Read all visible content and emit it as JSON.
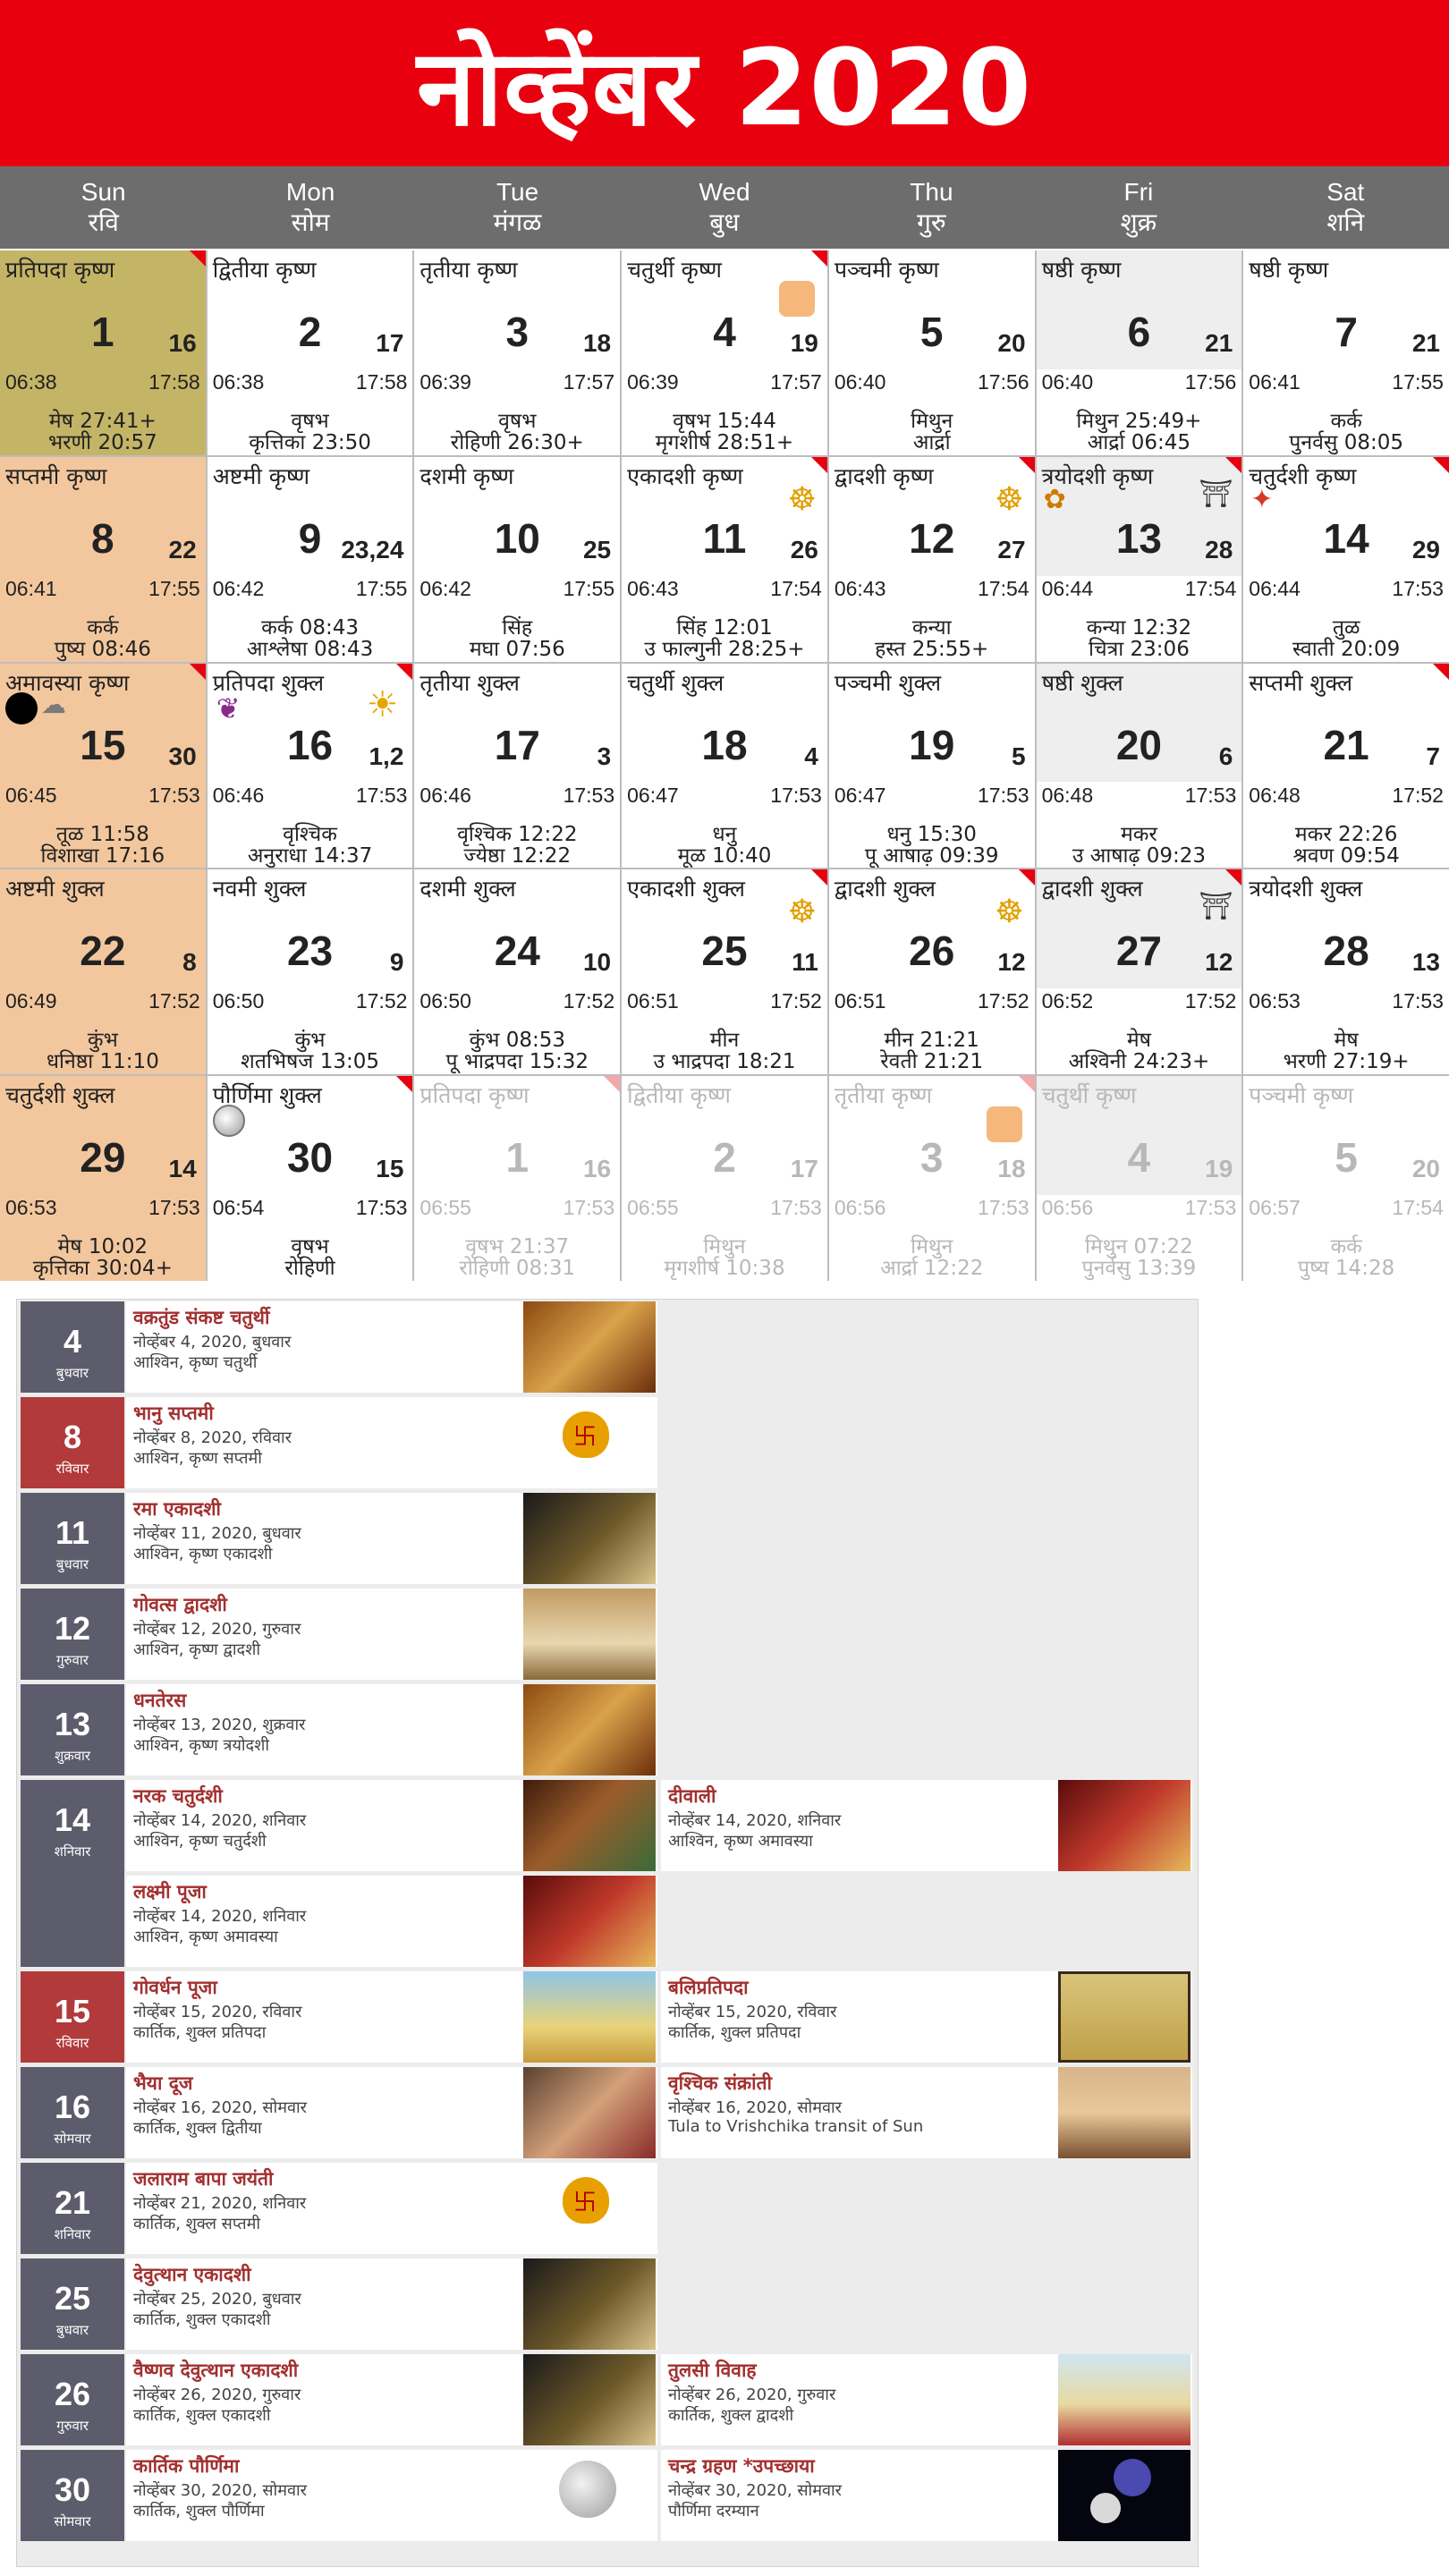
{
  "header": {
    "title": "नोव्हेंबर 2020"
  },
  "day_headers": [
    {
      "en": "Sun",
      "mr": "रवि"
    },
    {
      "en": "Mon",
      "mr": "सोम"
    },
    {
      "en": "Tue",
      "mr": "मंगळ"
    },
    {
      "en": "Wed",
      "mr": "बुध"
    },
    {
      "en": "Thu",
      "mr": "गुरु"
    },
    {
      "en": "Fri",
      "mr": "शुक्र"
    },
    {
      "en": "Sat",
      "mr": "शनि"
    }
  ],
  "calendar": {
    "cells": [
      {
        "tithi": "प्रतिपदा कृष्ण",
        "day": "1",
        "lunar": "16",
        "rise": "06:38",
        "set": "17:58",
        "l1": "मेष 27:41+",
        "l2": "भरणी 20:57",
        "style": "today",
        "corner": true
      },
      {
        "tithi": "द्वितीया कृष्ण",
        "day": "2",
        "lunar": "17",
        "rise": "06:38",
        "set": "17:58",
        "l1": "वृषभ",
        "l2": "कृत्तिका 23:50"
      },
      {
        "tithi": "तृतीया कृष्ण",
        "day": "3",
        "lunar": "18",
        "rise": "06:39",
        "set": "17:57",
        "l1": "वृषभ",
        "l2": "रोहिणी 26:30+"
      },
      {
        "tithi": "चतुर्थी कृष्ण",
        "day": "4",
        "lunar": "19",
        "rise": "06:39",
        "set": "17:57",
        "l1": "वृषभ 15:44",
        "l2": "मृगशीर्ष 28:51+",
        "corner": true,
        "icon": "ganesha-icon"
      },
      {
        "tithi": "पञ्चमी कृष्ण",
        "day": "5",
        "lunar": "20",
        "rise": "06:40",
        "set": "17:56",
        "l1": "मिथुन",
        "l2": "आर्द्रा"
      },
      {
        "tithi": "षष्ठी कृष्ण",
        "day": "6",
        "lunar": "21",
        "rise": "06:40",
        "set": "17:56",
        "l1": "मिथुन 25:49+",
        "l2": "आर्द्रा 06:45",
        "style": "shade"
      },
      {
        "tithi": "षष्ठी कृष्ण",
        "day": "7",
        "lunar": "21",
        "rise": "06:41",
        "set": "17:55",
        "l1": "कर्क",
        "l2": "पुनर्वसु 08:05"
      },
      {
        "tithi": "सप्तमी कृष्ण",
        "day": "8",
        "lunar": "22",
        "rise": "06:41",
        "set": "17:55",
        "l1": "कर्क",
        "l2": "पुष्य 08:46",
        "style": "sun"
      },
      {
        "tithi": "अष्टमी कृष्ण",
        "day": "9",
        "lunar": "23,24",
        "rise": "06:42",
        "set": "17:55",
        "l1": "कर्क 08:43",
        "l2": "आश्लेषा 08:43"
      },
      {
        "tithi": "दशमी कृष्ण",
        "day": "10",
        "lunar": "25",
        "rise": "06:42",
        "set": "17:55",
        "l1": "सिंह",
        "l2": "मघा 07:56"
      },
      {
        "tithi": "एकादशी कृष्ण",
        "day": "11",
        "lunar": "26",
        "rise": "06:43",
        "set": "17:54",
        "l1": "सिंह 12:01",
        "l2": "उ फाल्गुनी 28:25+",
        "corner": true,
        "icon": "vishnu-icon"
      },
      {
        "tithi": "द्वादशी कृष्ण",
        "day": "12",
        "lunar": "27",
        "rise": "06:43",
        "set": "17:54",
        "l1": "कन्या",
        "l2": "हस्त 25:55+",
        "corner": true,
        "icon": "vishnu-icon"
      },
      {
        "tithi": "त्रयोदशी कृष्ण",
        "day": "13",
        "lunar": "28",
        "rise": "06:44",
        "set": "17:54",
        "l1": "कन्या 12:32",
        "l2": "चित्रा 23:06",
        "style": "shade",
        "corner": true,
        "icon": "lakshmi-shiva-icon"
      },
      {
        "tithi": "चतुर्दशी कृष्ण",
        "day": "14",
        "lunar": "29",
        "rise": "06:44",
        "set": "17:53",
        "l1": "तुळ",
        "l2": "स्वाती 20:09",
        "corner": true,
        "icon": "diya-icon"
      },
      {
        "tithi": "अमावस्या कृष्ण",
        "day": "15",
        "lunar": "30",
        "rise": "06:45",
        "set": "17:53",
        "l1": "तूळ 11:58",
        "l2": "विशाखा 17:16",
        "style": "sun",
        "corner": true,
        "icon": "new-moon-icon"
      },
      {
        "tithi": "प्रतिपदा शुक्ल",
        "day": "16",
        "lunar": "1,2",
        "rise": "06:46",
        "set": "17:53",
        "l1": "वृश्चिक",
        "l2": "अनुराधा 14:37",
        "corner": true,
        "icon": "bhaidooj-sun-icon"
      },
      {
        "tithi": "तृतीया शुक्ल",
        "day": "17",
        "lunar": "3",
        "rise": "06:46",
        "set": "17:53",
        "l1": "वृश्चिक 12:22",
        "l2": "ज्येष्ठा 12:22"
      },
      {
        "tithi": "चतुर्थी शुक्ल",
        "day": "18",
        "lunar": "4",
        "rise": "06:47",
        "set": "17:53",
        "l1": "धनु",
        "l2": "मूळ 10:40"
      },
      {
        "tithi": "पञ्चमी शुक्ल",
        "day": "19",
        "lunar": "5",
        "rise": "06:47",
        "set": "17:53",
        "l1": "धनु 15:30",
        "l2": "पू आषाढ़ 09:39"
      },
      {
        "tithi": "षष्ठी शुक्ल",
        "day": "20",
        "lunar": "6",
        "rise": "06:48",
        "set": "17:53",
        "l1": "मकर",
        "l2": "उ आषाढ़ 09:23",
        "style": "shade"
      },
      {
        "tithi": "सप्तमी शुक्ल",
        "day": "21",
        "lunar": "7",
        "rise": "06:48",
        "set": "17:52",
        "l1": "मकर 22:26",
        "l2": "श्रवण 09:54",
        "corner": true
      },
      {
        "tithi": "अष्टमी शुक्ल",
        "day": "22",
        "lunar": "8",
        "rise": "06:49",
        "set": "17:52",
        "l1": "कुंभ",
        "l2": "धनिष्ठा 11:10",
        "style": "sun"
      },
      {
        "tithi": "नवमी शुक्ल",
        "day": "23",
        "lunar": "9",
        "rise": "06:50",
        "set": "17:52",
        "l1": "कुंभ",
        "l2": "शतभिषज 13:05"
      },
      {
        "tithi": "दशमी शुक्ल",
        "day": "24",
        "lunar": "10",
        "rise": "06:50",
        "set": "17:52",
        "l1": "कुंभ 08:53",
        "l2": "पू भाद्रपदा 15:32"
      },
      {
        "tithi": "एकादशी शुक्ल",
        "day": "25",
        "lunar": "11",
        "rise": "06:51",
        "set": "17:52",
        "l1": "मीन",
        "l2": "उ भाद्रपदा 18:21",
        "corner": true,
        "icon": "vishnu-icon"
      },
      {
        "tithi": "द्वादशी शुक्ल",
        "day": "26",
        "lunar": "12",
        "rise": "06:51",
        "set": "17:52",
        "l1": "मीन 21:21",
        "l2": "रेवती 21:21",
        "corner": true,
        "icon": "vishnu-icon"
      },
      {
        "tithi": "द्वादशी शुक्ल",
        "day": "27",
        "lunar": "12",
        "rise": "06:52",
        "set": "17:52",
        "l1": "मेष",
        "l2": "अश्विनी 24:23+",
        "style": "shade",
        "corner": true,
        "icon": "shiva-icon"
      },
      {
        "tithi": "त्रयोदशी शुक्ल",
        "day": "28",
        "lunar": "13",
        "rise": "06:53",
        "set": "17:53",
        "l1": "मेष",
        "l2": "भरणी 27:19+"
      },
      {
        "tithi": "चतुर्दशी शुक्ल",
        "day": "29",
        "lunar": "14",
        "rise": "06:53",
        "set": "17:53",
        "l1": "मेष 10:02",
        "l2": "कृत्तिका 30:04+",
        "style": "sun"
      },
      {
        "tithi": "पौर्णिमा शुक्ल",
        "day": "30",
        "lunar": "15",
        "rise": "06:54",
        "set": "17:53",
        "l1": "वृषभ",
        "l2": "रोहिणी",
        "corner": true,
        "icon": "full-moon-icon"
      },
      {
        "tithi": "प्रतिपदा कृष्ण",
        "day": "1",
        "lunar": "16",
        "rise": "06:55",
        "set": "17:53",
        "l1": "वृषभ 21:37",
        "l2": "रोहिणी 08:31",
        "style": "next",
        "corner": true
      },
      {
        "tithi": "द्वितीया कृष्ण",
        "day": "2",
        "lunar": "17",
        "rise": "06:55",
        "set": "17:53",
        "l1": "मिथुन",
        "l2": "मृगशीर्ष 10:38",
        "style": "next"
      },
      {
        "tithi": "तृतीया कृष्ण",
        "day": "3",
        "lunar": "18",
        "rise": "06:56",
        "set": "17:53",
        "l1": "मिथुन",
        "l2": "आर्द्रा 12:22",
        "style": "next",
        "corner": true,
        "icon": "ganesha-icon"
      },
      {
        "tithi": "चतुर्थी कृष्ण",
        "day": "4",
        "lunar": "19",
        "rise": "06:56",
        "set": "17:53",
        "l1": "मिथुन 07:22",
        "l2": "पुनर्वसु 13:39",
        "style": "next shade"
      },
      {
        "tithi": "पञ्चमी कृष्ण",
        "day": "5",
        "lunar": "20",
        "rise": "06:57",
        "set": "17:54",
        "l1": "कर्क",
        "l2": "पुष्य 14:28",
        "style": "next"
      }
    ]
  },
  "festivals": [
    {
      "date": "4",
      "weekday": "बुधवार",
      "sunday": false,
      "events": [
        {
          "name": "वक्रतुंड संकष्ट चतुर्थी",
          "d1": "नोव्हेंबर 4, 2020, बुधवार",
          "d2": "आश्विन, कृष्ण चतुर्थी",
          "img": "gold",
          "icon": "ganesha-image"
        }
      ]
    },
    {
      "date": "8",
      "weekday": "रविवार",
      "sunday": true,
      "events": [
        {
          "name": "भानु सप्तमी",
          "d1": "नोव्हेंबर 8, 2020, रविवार",
          "d2": "आश्विन, कृष्ण सप्तमी",
          "img": "kalash",
          "icon": "kalash-image"
        }
      ]
    },
    {
      "date": "11",
      "weekday": "बुधवार",
      "sunday": false,
      "events": [
        {
          "name": "रमा एकादशी",
          "d1": "नोव्हेंबर 11, 2020, बुधवार",
          "d2": "आश्विन, कृष्ण एकादशी",
          "img": "vishnu",
          "icon": "vishnu-image"
        }
      ]
    },
    {
      "date": "12",
      "weekday": "गुरुवार",
      "sunday": false,
      "events": [
        {
          "name": "गोवत्स द्वादशी",
          "d1": "नोव्हेंबर 12, 2020, गुरुवार",
          "d2": "आश्विन, कृष्ण द्वादशी",
          "img": "cow",
          "icon": "cow-image"
        }
      ]
    },
    {
      "date": "13",
      "weekday": "शुक्रवार",
      "sunday": false,
      "events": [
        {
          "name": "धनतेरस",
          "d1": "नोव्हेंबर 13, 2020, शुक्रवार",
          "d2": "आश्विन, कृष्ण त्रयोदशी",
          "img": "gold",
          "icon": "lakshmi-image"
        }
      ]
    },
    {
      "date": "14",
      "weekday": "शनिवार",
      "sunday": false,
      "double": true,
      "events": [
        {
          "name": "नरक चतुर्दशी",
          "d1": "नोव्हेंबर 14, 2020, शनिवार",
          "d2": "आश्विन, कृष्ण चतुर्दशी",
          "img": "lady",
          "icon": "abhyanga-image"
        },
        {
          "name": "दीवाली",
          "d1": "नोव्हेंबर 14, 2020, शनिवार",
          "d2": "आश्विन, कृष्ण अमावस्या",
          "img": "diwali",
          "icon": "diwali-image"
        },
        {
          "name": "लक्ष्मी पूजा",
          "d1": "नोव्हेंबर 14, 2020, शनिवार",
          "d2": "आश्विन, कृष्ण अमावस्या",
          "img": "diwali",
          "icon": "lakshmi-puja-image"
        }
      ]
    },
    {
      "date": "15",
      "weekday": "रविवार",
      "sunday": true,
      "events": [
        {
          "name": "गोवर्धन पूजा",
          "d1": "नोव्हेंबर 15, 2020, रविवार",
          "d2": "कार्तिक, शुक्ल प्रतिपदा",
          "img": "hill",
          "icon": "govardhan-image"
        },
        {
          "name": "बलिप्रतिपदा",
          "d1": "नोव्हेंबर 15, 2020, रविवार",
          "d2": "कार्तिक, शुक्ल प्रतिपदा",
          "img": "folk",
          "icon": "bali-image"
        }
      ]
    },
    {
      "date": "16",
      "weekday": "सोमवार",
      "sunday": false,
      "events": [
        {
          "name": "भैया दूज",
          "d1": "नोव्हेंबर 16, 2020, सोमवार",
          "d2": "कार्तिक, शुक्ल द्वितीया",
          "img": "bhai",
          "icon": "bhaidooj-image"
        },
        {
          "name": "वृश्चिक संक्रांती",
          "d1": "नोव्हेंबर 16, 2020, सोमवार",
          "d2": "Tula to Vrishchika transit of Sun",
          "img": "sunset",
          "icon": "sankranti-image"
        }
      ]
    },
    {
      "date": "21",
      "weekday": "शनिवार",
      "sunday": false,
      "events": [
        {
          "name": "जलाराम बापा जयंती",
          "d1": "नोव्हेंबर 21, 2020, शनिवार",
          "d2": "कार्तिक, शुक्ल सप्तमी",
          "img": "kalash",
          "icon": "kalash-image"
        }
      ]
    },
    {
      "date": "25",
      "weekday": "बुधवार",
      "sunday": false,
      "events": [
        {
          "name": "देवुत्थान एकादशी",
          "d1": "नोव्हेंबर 25, 2020, बुधवार",
          "d2": "कार्तिक, शुक्ल एकादशी",
          "img": "vishnu",
          "icon": "vishnu-image"
        }
      ]
    },
    {
      "date": "26",
      "weekday": "गुरुवार",
      "sunday": false,
      "events": [
        {
          "name": "वैष्णव देवुत्थान एकादशी",
          "d1": "नोव्हेंबर 26, 2020, गुरुवार",
          "d2": "कार्तिक, शुक्ल एकादशी",
          "img": "vishnu",
          "icon": "vishnu-image"
        },
        {
          "name": "तुलसी विवाह",
          "d1": "नोव्हेंबर 26, 2020, गुरुवार",
          "d2": "कार्तिक, शुक्ल द्वादशी",
          "img": "tulsi",
          "icon": "tulsi-image"
        }
      ]
    },
    {
      "date": "30",
      "weekday": "सोमवार",
      "sunday": false,
      "events": [
        {
          "name": "कार्तिक पौर्णिमा",
          "d1": "नोव्हेंबर 30, 2020, सोमवार",
          "d2": "कार्तिक, शुक्ल पौर्णिमा",
          "img": "moon",
          "icon": "full-moon-image"
        },
        {
          "name": "चन्द्र ग्रहण *उपच्छाया",
          "d1": "नोव्हेंबर 30, 2020, सोमवार",
          "d2": "पौर्णिमा दरम्यान",
          "img": "eclipse",
          "icon": "eclipse-image"
        }
      ]
    }
  ],
  "colors": {
    "header_red": "#e8000f",
    "day_header_gray": "#6d6d6d",
    "sunday_peach": "#f3c79d",
    "today_olive": "#c4b466",
    "festival_red": "#a33030"
  }
}
